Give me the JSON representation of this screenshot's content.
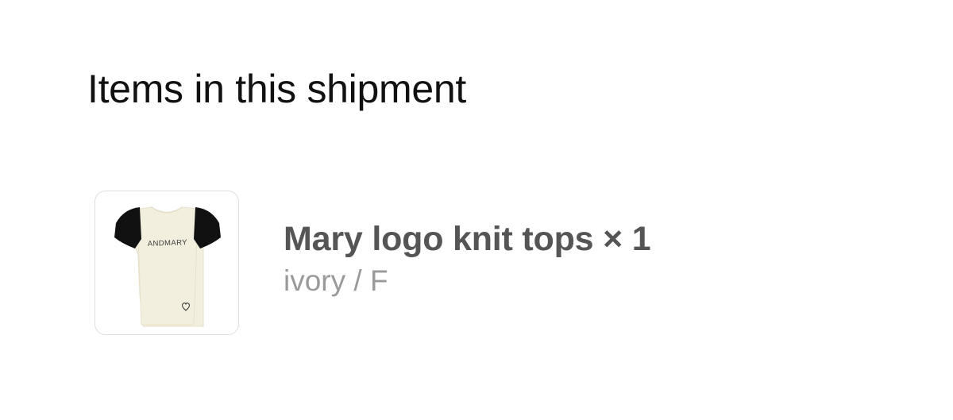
{
  "shipment": {
    "title": "Items in this shipment",
    "items": [
      {
        "name": "Mary logo knit tops",
        "quantity_text": "× 1",
        "option": "ivory / F",
        "image": {
          "icon": "knit-top-product-image",
          "brand_text": "ANDMARY",
          "colors": {
            "body": "#f3efde",
            "sleeves": "#111111"
          }
        }
      }
    ]
  },
  "colors": {
    "title_text": "#111111",
    "item_name_text": "#555555",
    "option_text": "#9a9a9a",
    "thumb_border": "#dedede"
  }
}
